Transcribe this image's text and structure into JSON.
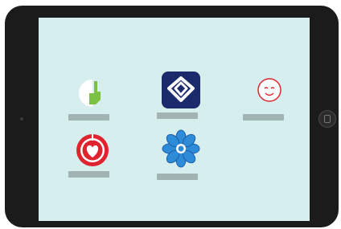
{
  "device": {
    "name": "Tablet"
  },
  "screen": {
    "background": "#d6eeee",
    "apps": [
      {
        "id": "app-1",
        "icon": "pointing-hand-icon",
        "label": ""
      },
      {
        "id": "app-2",
        "icon": "heart-shield-icon",
        "label": ""
      },
      {
        "id": "app-3",
        "icon": "smiley-face-icon",
        "label": ""
      },
      {
        "id": "app-4",
        "icon": "heart-target-icon",
        "label": ""
      },
      {
        "id": "app-5",
        "icon": "blue-flower-icon",
        "label": ""
      }
    ]
  },
  "colors": {
    "label_placeholder": "#a1b3b3",
    "icon_green": "#7cc242",
    "icon_navy": "#1b2a6b",
    "icon_red": "#e0242f",
    "icon_blue": "#2e8bd8"
  }
}
